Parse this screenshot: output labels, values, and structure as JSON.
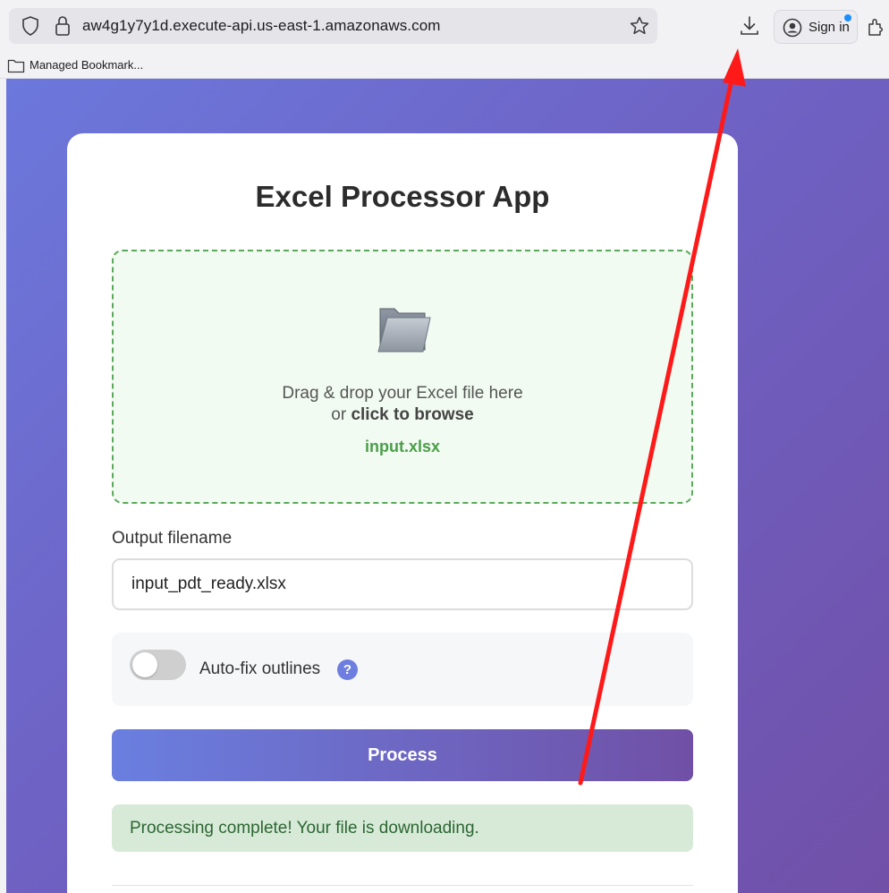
{
  "browser": {
    "url": "aw4g1y7y1d.execute-api.us-east-1.amazonaws.com",
    "sign_in_label": "Sign in",
    "bookmark_label": "Managed Bookmark..."
  },
  "app": {
    "title": "Excel Processor App",
    "dropzone": {
      "line1": "Drag & drop your Excel file here",
      "line2_prefix": "or ",
      "line2_bold": "click to browse",
      "selected_file": "input.xlsx"
    },
    "output_label": "Output filename",
    "output_value": "input_pdt_ready.xlsx",
    "option_label": "Auto-fix outlines",
    "option_help": "?",
    "option_enabled": false,
    "process_label": "Process",
    "status_message": "Processing complete! Your file is downloading."
  },
  "colors": {
    "annotation_arrow": "#ff1a1a",
    "dropzone_border": "#5aa85a",
    "status_text": "#2c6632",
    "gradient_start": "#6a7fe0",
    "gradient_end": "#7050a6"
  },
  "icons": [
    "shield-icon",
    "lock-icon",
    "star-icon",
    "download-icon",
    "account-icon",
    "extensions-icon",
    "folder-icon",
    "folder-large-icon",
    "help-icon"
  ]
}
